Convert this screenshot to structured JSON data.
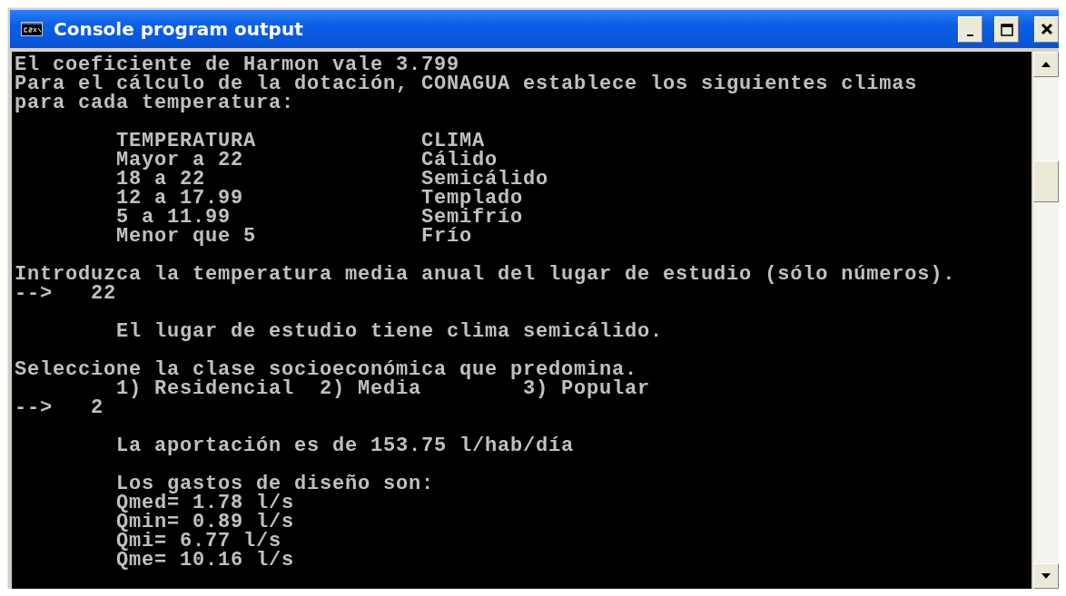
{
  "window": {
    "title": "Console program output"
  },
  "console": {
    "blocks": [
      {
        "lines": [
          "El coeficiente de Harmon vale 3.799",
          "Para el cálculo de la dotación, CONAGUA establece los siguientes climas",
          "para cada temperatura:"
        ]
      },
      {
        "lines": [
          "        TEMPERATURA             CLIMA",
          "        Mayor a 22              Cálido",
          "        18 a 22                 Semicálido",
          "        12 a 17.99              Templado",
          "        5 a 11.99               Semifrío",
          "        Menor que 5             Frío"
        ]
      },
      {
        "lines": [
          "Introduzca la temperatura media anual del lugar de estudio (sólo números).",
          "-->   22"
        ]
      },
      {
        "lines": [
          "        El lugar de estudio tiene clima semicálido."
        ]
      },
      {
        "lines": [
          "Seleccione la clase socioeconómica que predomina.",
          "        1) Residencial  2) Media        3) Popular",
          "-->   2"
        ]
      },
      {
        "lines": [
          "        La aportación es de 153.75 l/hab/día"
        ]
      },
      {
        "lines": [
          "        Los gastos de diseño son:",
          "        Qmed= 1.78 l/s",
          "        Qmin= 0.89 l/s",
          "        Qmi= 6.77 l/s",
          "        Qme= 10.16 l/s"
        ]
      }
    ]
  }
}
